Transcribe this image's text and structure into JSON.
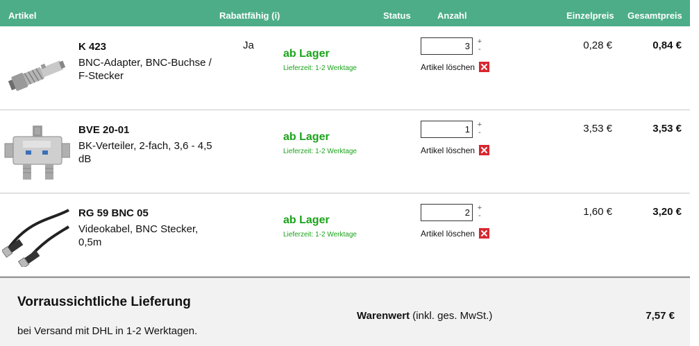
{
  "header": {
    "artikel": "Artikel",
    "rabattfaehig": "Rabattfähig (i)",
    "status": "Status",
    "anzahl": "Anzahl",
    "einzelpreis": "Einzelpreis",
    "gesamtpreis": "Gesamtpreis"
  },
  "items": [
    {
      "code": "K 423",
      "description": "BNC-Adapter, BNC-Buchse / F-Stecker",
      "rabatt": "Ja",
      "status": "ab Lager",
      "lieferzeit": "Lieferzeit: 1-2 Werktage",
      "quantity": "3",
      "stepper_plus": "+",
      "stepper_minus": "-",
      "delete_label": "Artikel löschen",
      "unit_price": "0,28 €",
      "total_price": "0,84 €",
      "image_icon": "bnc-adapter-image"
    },
    {
      "code": "BVE 20-01",
      "description": "BK-Verteiler, 2-fach, 3,6 - 4,5 dB",
      "rabatt": "",
      "status": "ab Lager",
      "lieferzeit": "Lieferzeit: 1-2 Werktage",
      "quantity": "1",
      "stepper_plus": "+",
      "stepper_minus": "-",
      "delete_label": "Artikel löschen",
      "unit_price": "3,53 €",
      "total_price": "3,53 €",
      "image_icon": "splitter-image"
    },
    {
      "code": "RG 59 BNC 05",
      "description": "Videokabel, BNC Stecker, 0,5m",
      "rabatt": "",
      "status": "ab Lager",
      "lieferzeit": "Lieferzeit: 1-2 Werktage",
      "quantity": "2",
      "stepper_plus": "+",
      "stepper_minus": "-",
      "delete_label": "Artikel löschen",
      "unit_price": "1,60 €",
      "total_price": "3,20 €",
      "image_icon": "bnc-cable-image"
    }
  ],
  "footer": {
    "heading": "Vorraussichtliche Lieferung",
    "shipping_text": "bei Versand mit DHL in 1-2 Werktagen.",
    "warenwert_label": "Warenwert",
    "warenwert_note": " (inkl. ges. MwSt.)",
    "total": "7,57 €"
  },
  "colors": {
    "header_bg": "#4cad88",
    "status_green": "#1aa31a",
    "delete_red": "#d9262e",
    "footer_bg": "#f2f2f2"
  }
}
